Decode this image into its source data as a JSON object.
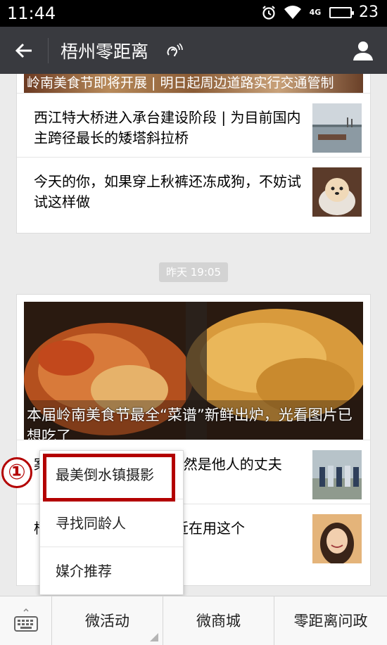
{
  "status_bar": {
    "time": "11:44",
    "battery": "23",
    "network": "4G"
  },
  "header": {
    "title": "梧州零距离"
  },
  "feed": {
    "card1": {
      "cut_title": "岭南美食节即将开展 | 明日起周边道路实行交通管制",
      "articles": [
        {
          "title": "西江特大桥进入承台建设阶段 | 为目前国内主跨径最长的矮塔斜拉桥"
        },
        {
          "title": "今天的你，如果穿上秋裤还冻成狗，不妨试试这样做"
        }
      ]
    },
    "time_label": "昨天 19:05",
    "card2": {
      "hero_caption": "本届岭南美食节最全“菜谱”新鲜出炉，光看图片已想吃了",
      "articles": [
        {
          "title": "案件在3日侦破，嫌犯竟然是他人的丈夫"
        },
        {
          "title": "梧州一个爱笑的女孩最近在用这个"
        }
      ]
    }
  },
  "popup_menu": {
    "items": [
      "最美倒水镇摄影",
      "寻找同龄人",
      "媒介推荐"
    ]
  },
  "annotation": {
    "marker": "①"
  },
  "bottom_bar": {
    "tabs": [
      "微活动",
      "微商城",
      "零距离问政"
    ]
  }
}
